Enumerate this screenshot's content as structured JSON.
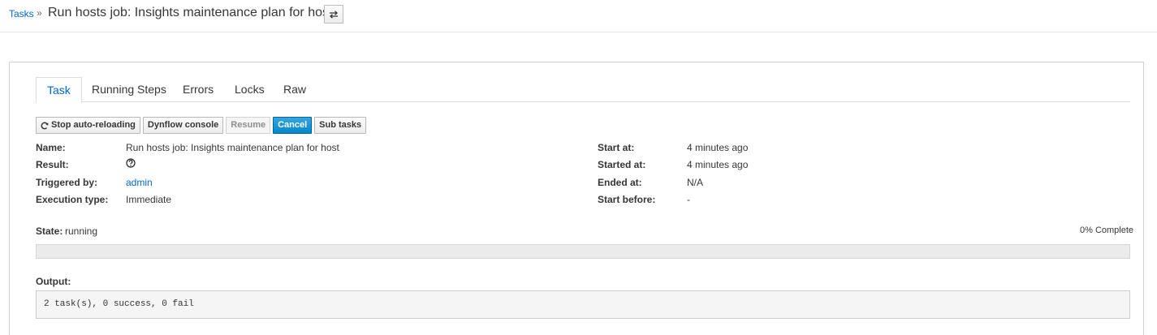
{
  "breadcrumb": {
    "parent": "Tasks",
    "separator": "»",
    "title": "Run hosts job: Insights maintenance plan for host"
  },
  "tabs": [
    {
      "label": "Task",
      "active": true
    },
    {
      "label": "Running Steps",
      "active": false
    },
    {
      "label": "Errors",
      "active": false
    },
    {
      "label": "Locks",
      "active": false
    },
    {
      "label": "Raw",
      "active": false
    }
  ],
  "buttons": {
    "stop_reload": "Stop auto-reloading",
    "dynflow": "Dynflow console",
    "resume": "Resume",
    "cancel": "Cancel",
    "subtasks": "Sub tasks"
  },
  "details": {
    "name_label": "Name:",
    "name_value": "Run hosts job: Insights maintenance plan for host",
    "result_label": "Result:",
    "triggered_label": "Triggered by:",
    "triggered_value": "admin",
    "exec_label": "Execution type:",
    "exec_value": "Immediate",
    "start_at_label": "Start at:",
    "start_at_value": "4 minutes ago",
    "started_at_label": "Started at:",
    "started_at_value": "4 minutes ago",
    "ended_at_label": "Ended at:",
    "ended_at_value": "N/A",
    "start_before_label": "Start before:",
    "start_before_value": "-"
  },
  "state": {
    "label": "State:",
    "value": "running",
    "progress_text": "0% Complete",
    "progress_percent": 0
  },
  "output": {
    "label": "Output:",
    "text": "2 task(s), 0 success, 0 fail"
  },
  "colors": {
    "link": "#0066cc",
    "primary": "#0088ce"
  },
  "icons": {
    "switch": "switch-icon",
    "refresh": "refresh-icon",
    "result": "question-circle-icon"
  }
}
